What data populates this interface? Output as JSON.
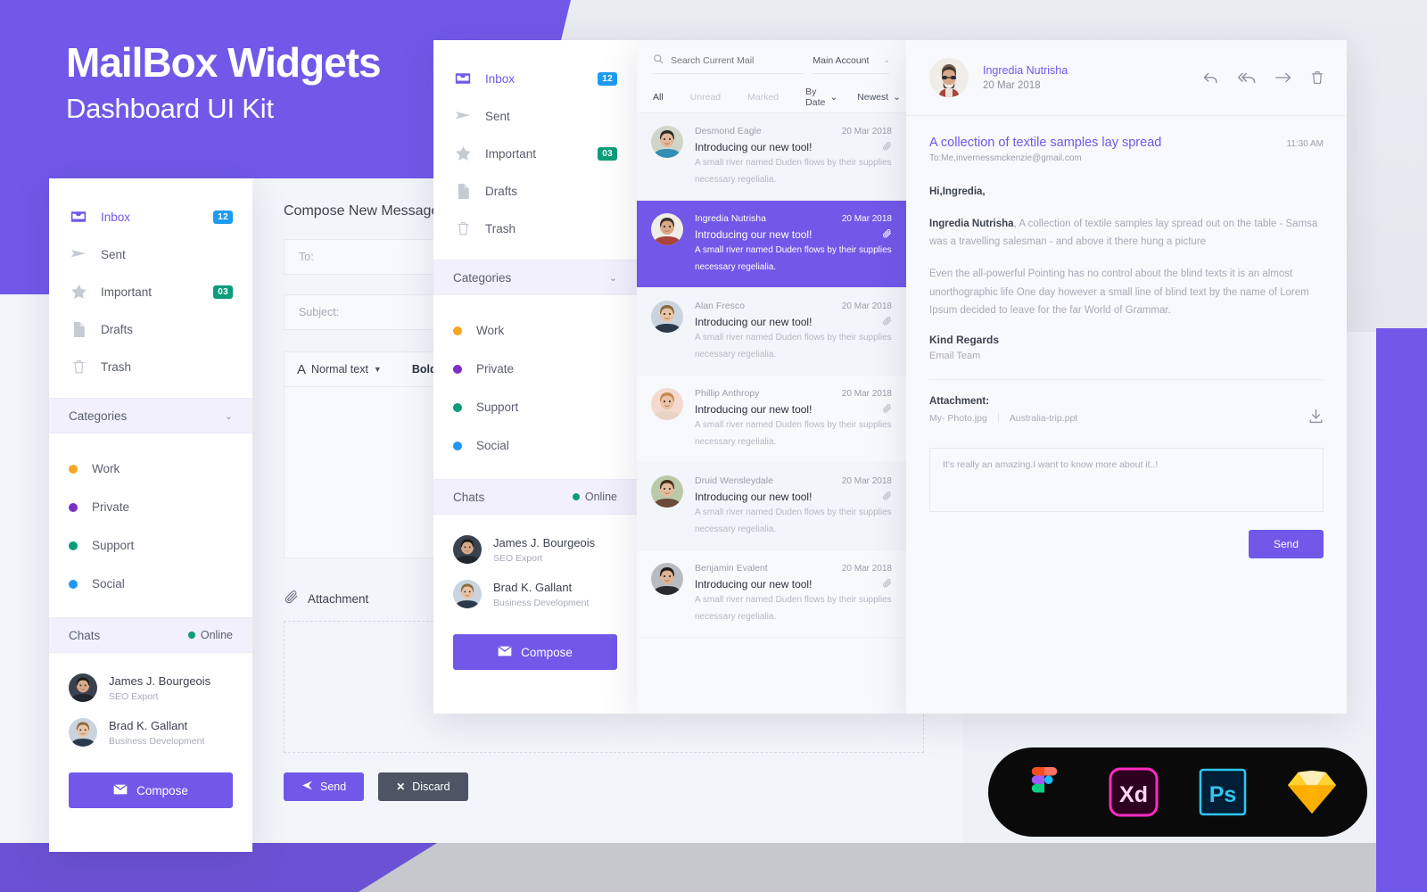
{
  "hero": {
    "title": "MailBox Widgets",
    "subtitle": "Dashboard UI Kit"
  },
  "colors": {
    "brand_purple": "#7158e8",
    "badge_blue": "#1e9bf0",
    "badge_green": "#0a9d79",
    "cat_work": "#f5a623",
    "cat_private": "#7b2fc4",
    "cat_support": "#0a9d79",
    "cat_social": "#2196f3",
    "discard_dark": "#4d5463"
  },
  "sidebar": {
    "nav": [
      {
        "label": "Inbox",
        "icon": "inbox-icon",
        "badge": "12",
        "badge_color": "blue",
        "active": true
      },
      {
        "label": "Sent",
        "icon": "send-icon",
        "badge": "",
        "badge_color": "",
        "active": false
      },
      {
        "label": "Important",
        "icon": "star-icon",
        "badge": "03",
        "badge_color": "green",
        "active": false
      },
      {
        "label": "Drafts",
        "icon": "document-icon",
        "badge": "",
        "badge_color": "",
        "active": false
      },
      {
        "label": "Trash",
        "icon": "trash-icon",
        "badge": "",
        "badge_color": "",
        "active": false
      }
    ],
    "categories_header": "Categories",
    "categories": [
      {
        "label": "Work",
        "color": "#f5a623"
      },
      {
        "label": "Private",
        "color": "#7b2fc4"
      },
      {
        "label": "Support",
        "color": "#0a9d79"
      },
      {
        "label": "Social",
        "color": "#2196f3"
      }
    ],
    "chats_header": "Chats",
    "online_label": "Online",
    "chats": [
      {
        "name": "James J. Bourgeois",
        "role": "SEO Export"
      },
      {
        "name": "Brad K. Gallant",
        "role": "Business Development"
      }
    ],
    "compose_label": "Compose"
  },
  "compose": {
    "title": "Compose New Message",
    "to_placeholder": "To:",
    "subject_placeholder": "Subject:",
    "toolbar_style": "Normal text",
    "toolbar_bold": "Bold",
    "attachment_label": "Attachment",
    "send_label": "Send",
    "discard_label": "Discard"
  },
  "maillist": {
    "search_placeholder": "Search Current Mail",
    "search_value": "",
    "account": "Main Account",
    "tabs": [
      {
        "label": "All",
        "active": true
      },
      {
        "label": "Unread",
        "active": false
      },
      {
        "label": "Marked",
        "active": false
      }
    ],
    "sort_by": "By Date",
    "sort_order": "Newest",
    "items": [
      {
        "from": "Desmond Eagle",
        "date": "20 Mar 2018",
        "subject": "Introducing our new tool!",
        "preview": "A small river named Duden flows by their supplies necessary regelialia.",
        "selected": false,
        "has_attachment": true
      },
      {
        "from": "Ingredia Nutrisha",
        "date": "20 Mar 2018",
        "subject": "Introducing our new tool!",
        "preview": "A small river named Duden flows by their supplies necessary regelialia.",
        "selected": true,
        "has_attachment": true
      },
      {
        "from": "Alan Fresco",
        "date": "20 Mar 2018",
        "subject": "Introducing our new tool!",
        "preview": "A small river named Duden flows by their supplies necessary regelialia.",
        "selected": false,
        "has_attachment": true
      },
      {
        "from": "Phillip Anthropy",
        "date": "20 Mar 2018",
        "subject": "Introducing our new tool!",
        "preview": "A small river named Duden flows by their supplies necessary regelialia.",
        "selected": false,
        "has_attachment": true
      },
      {
        "from": "Druid Wensleydale",
        "date": "20 Mar 2018",
        "subject": "Introducing our new tool!",
        "preview": "A small river named Duden flows by their supplies necessary regelialia.",
        "selected": false,
        "has_attachment": true
      },
      {
        "from": "Benjamin Evalent",
        "date": "20 Mar 2018",
        "subject": "Introducing our new tool!",
        "preview": "A small river named Duden flows by their supplies necessary regelialia.",
        "selected": false,
        "has_attachment": true
      }
    ]
  },
  "reader": {
    "sender": "Ingredia Nutrisha",
    "date": "20 Mar 2018",
    "actions": [
      "reply-icon",
      "reply-all-icon",
      "forward-icon",
      "trash-icon"
    ],
    "subject": "A collection of textile samples lay spread",
    "time": "11:30 AM",
    "to": "To:Me,invernessmckenzie@gmail.com",
    "greeting": "Hi,Ingredia,",
    "para1_bold": "Ingredia Nutrisha",
    "para1_rest": ", A collection of textile samples lay spread out on the table - Samsa was a travelling salesman - and above it there hung a picture",
    "para2": "Even the all-powerful Pointing has no control about the blind texts it is an almost unorthographic life One day however a small line of blind text by the name of Lorem Ipsum decided to leave for the far World of Grammar.",
    "sign_off": "Kind Regards",
    "sign_team": "Email Team",
    "attachment_title": "Attachment:",
    "attachments": [
      "My- Photo.jpg",
      "Australia-trip.ppt"
    ],
    "reply_placeholder": "It's really an amazing.I want to know more about it..!",
    "send_label": "Send"
  },
  "tools": [
    {
      "name": "figma-logo"
    },
    {
      "name": "adobe-xd-logo"
    },
    {
      "name": "photoshop-logo"
    },
    {
      "name": "sketch-logo"
    }
  ]
}
